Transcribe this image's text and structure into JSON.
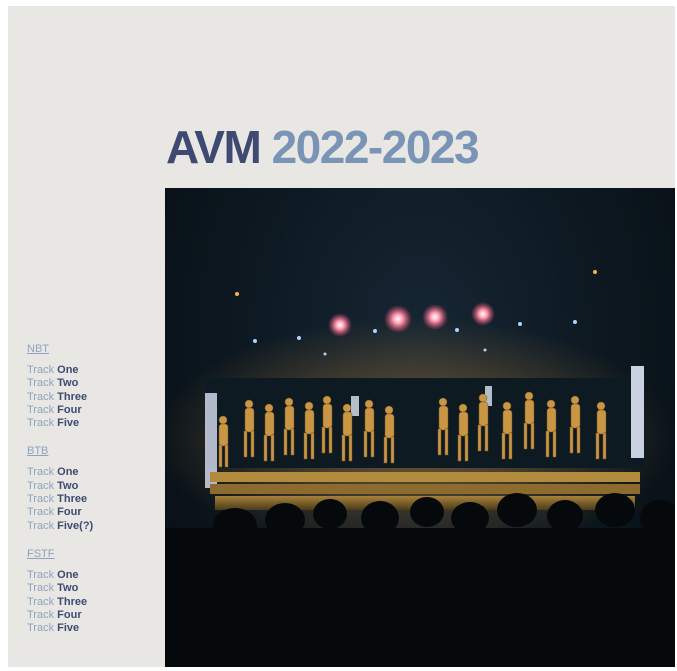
{
  "album": {
    "title_part1": "AVM",
    "title_part2": "2022-2023",
    "colors": {
      "background": "#e9e7e3",
      "navy": "#3e4a72",
      "slate_blue": "#7a94b5",
      "light_blue": "#8ea3bf"
    }
  },
  "tracklist": [
    {
      "label": "NBT",
      "tracks": [
        {
          "prefix": "Track",
          "number": "One"
        },
        {
          "prefix": "Track",
          "number": "Two"
        },
        {
          "prefix": "Track",
          "number": "Three"
        },
        {
          "prefix": "Track",
          "number": "Four"
        },
        {
          "prefix": "Track",
          "number": "Five"
        }
      ]
    },
    {
      "label": "BTB",
      "tracks": [
        {
          "prefix": "Track",
          "number": "One"
        },
        {
          "prefix": "Track",
          "number": "Two"
        },
        {
          "prefix": "Track",
          "number": "Three"
        },
        {
          "prefix": "Track",
          "number": "Four"
        },
        {
          "prefix": "Track",
          "number": "Five(?)"
        }
      ]
    },
    {
      "label": "FSTF",
      "tracks": [
        {
          "prefix": "Track",
          "number": "One"
        },
        {
          "prefix": "Track",
          "number": "Two"
        },
        {
          "prefix": "Track",
          "number": "Three"
        },
        {
          "prefix": "Track",
          "number": "Four"
        },
        {
          "prefix": "Track",
          "number": "Five"
        }
      ]
    }
  ]
}
